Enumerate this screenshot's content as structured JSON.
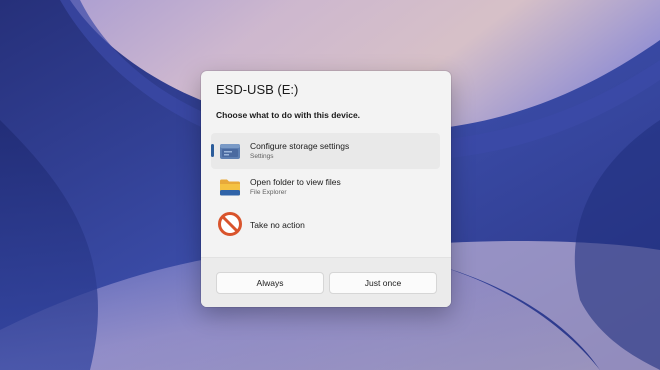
{
  "dialog": {
    "title": "ESD-USB (E:)",
    "prompt": "Choose what to do with this device.",
    "options": [
      {
        "label": "Configure storage settings",
        "sublabel": "Settings",
        "icon": "storage-drive-icon",
        "selected": true
      },
      {
        "label": "Open folder to view files",
        "sublabel": "File Explorer",
        "icon": "folder-icon",
        "selected": false
      },
      {
        "label": "Take no action",
        "icon": "no-action-icon",
        "selected": false
      }
    ],
    "buttons": {
      "always": "Always",
      "just_once": "Just once"
    }
  },
  "colors": {
    "accent": "#2b5c9a",
    "dialog_bg": "#f3f3f3",
    "footer_bg": "#ebebeb",
    "no_action_red": "#d9542c",
    "folder_yellow": "#f5c242"
  }
}
